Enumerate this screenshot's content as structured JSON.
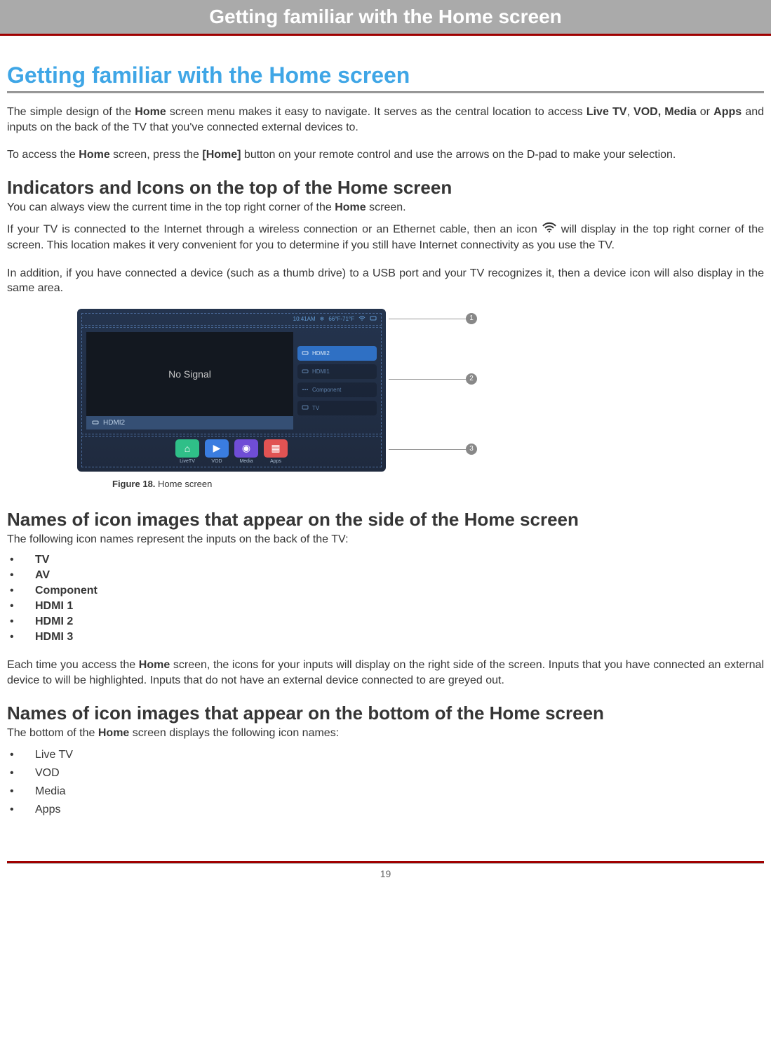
{
  "header": {
    "title": "Getting familiar with the Home screen"
  },
  "title": "Getting familiar with the Home screen",
  "intro": {
    "p1a": "The simple design of the ",
    "p1b": " screen menu makes it easy to navigate. It serves as the central location to access ",
    "p1c": " or ",
    "p1d": " and inputs on the back of the TV that you've connected external devices to.",
    "home": "Home",
    "livetv": "Live TV",
    "vod_media": "VOD, Media",
    "apps": "Apps"
  },
  "access": {
    "a1": "To access the ",
    "a2": " screen, press the ",
    "a3": " button on your remote control and use the arrows on the D-pad to make your selection.",
    "home": "Home",
    "btn": "[Home]"
  },
  "indicators": {
    "heading": "Indicators and Icons on the top of the Home screen",
    "p1a": "You can always view the current time in the top right corner of the ",
    "p1b": " screen.",
    "home": "Home",
    "p2": "If your TV is connected to the Internet through a wireless connection or an Ethernet cable, then an icon ",
    "p2b": " will display in the top right corner of the screen. This location makes it very convenient for you to determine if you still have Internet connectivity as you use the TV.",
    "p3": "In addition, if you have connected a device (such as a thumb drive) to a USB port and your TV recognizes it, then a device icon will also display in the same area."
  },
  "figure": {
    "status": {
      "time": "10:41AM",
      "temp": "66°F-71°F"
    },
    "no_signal": "No Signal",
    "current": "HDMI2",
    "inputs": [
      "HDMI2",
      "HDMI1",
      "Component",
      "TV"
    ],
    "apps": [
      {
        "label": "LiveTV"
      },
      {
        "label": "VOD"
      },
      {
        "label": "Media"
      },
      {
        "label": "Apps"
      }
    ],
    "callouts": [
      "1",
      "2",
      "3"
    ],
    "caption_b": "Figure 18.",
    "caption_t": " Home screen"
  },
  "side_icons": {
    "heading": "Names of icon images that appear on the side of the Home screen",
    "intro": "The following icon names represent the inputs on the back of the TV:",
    "items": [
      "TV",
      "AV",
      "Component",
      "HDMI 1",
      "HDMI 2",
      "HDMI 3"
    ],
    "p1a": "Each time you access the ",
    "p1b": " screen, the icons for your inputs will display on the right side of the screen. Inputs that you have connected an external device to will be highlighted. Inputs that do not have an external device connected to are greyed out.",
    "home": "Home"
  },
  "bottom_icons": {
    "heading": "Names of icon images that appear on the bottom of the Home screen",
    "intro_a": "The bottom of the ",
    "intro_b": " screen displays the following icon names:",
    "home": "Home",
    "items": [
      "Live TV",
      "VOD",
      "Media",
      "Apps"
    ]
  },
  "page_number": "19"
}
